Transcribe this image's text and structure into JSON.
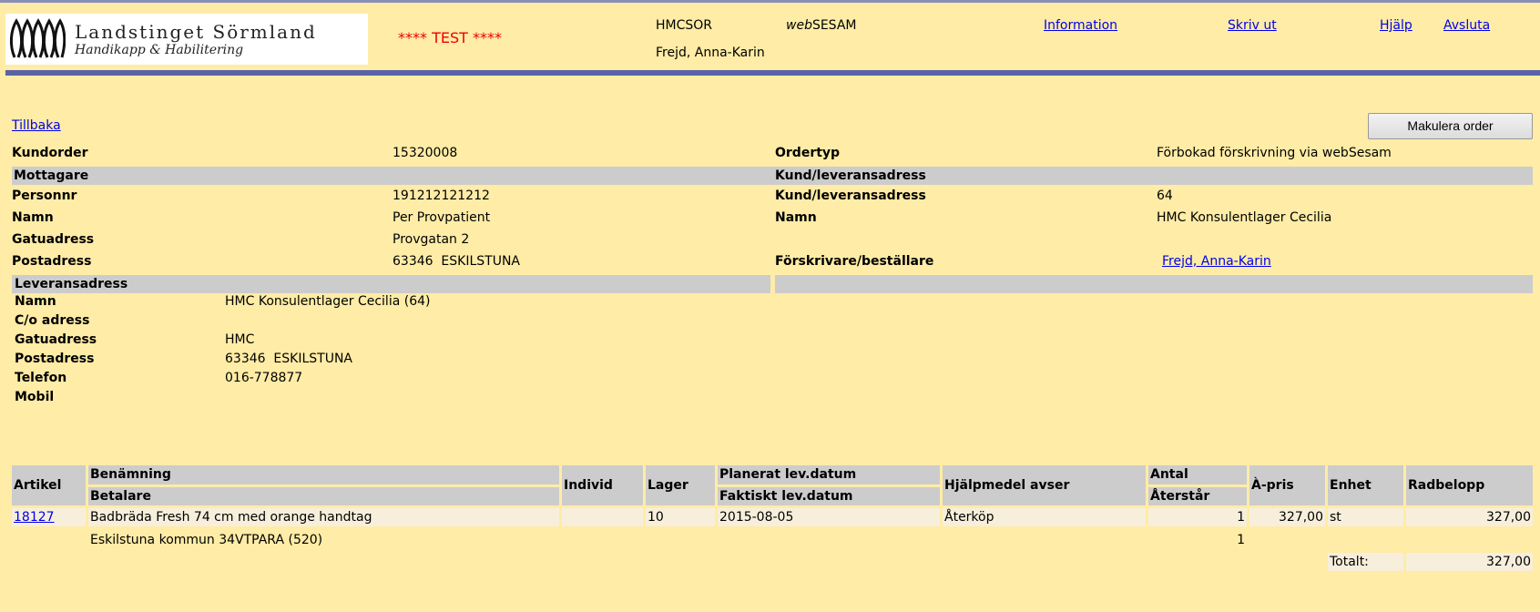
{
  "header": {
    "logo_line1": "Landstinget Sörmland",
    "logo_line2": "Handikapp & Habilitering",
    "test_label": "**** TEST ****",
    "system_code": "HMCSOR",
    "app_name_italic": "web",
    "app_name_rest": "SESAM",
    "user": "Frejd, Anna-Karin",
    "links": [
      "Information",
      "Skriv ut",
      "Hjälp",
      "Avsluta"
    ]
  },
  "nav": {
    "back": "Tillbaka",
    "cancel_order": "Makulera order"
  },
  "order": {
    "kundorder_label": "Kundorder",
    "kundorder": "15320008",
    "ordertyp_label": "Ordertyp",
    "ordertyp": "Förbokad förskrivning via webSesam",
    "mottagare_band": "Mottagare",
    "kund_band": "Kund/leveransadress",
    "personnr_label": "Personnr",
    "personnr": "191212121212",
    "kundlev_label": "Kund/leveransadress",
    "kundlev": "64",
    "namn_label": "Namn",
    "namn": "Per Provpatient",
    "namn2_label": "Namn",
    "namn2": "HMC Konsulentlager Cecilia",
    "gatuadress_label": "Gatuadress",
    "gatuadress": "Provgatan 2",
    "postadress_label": "Postadress",
    "postadress": "63346  ESKILSTUNA",
    "forskrivare_label": "Förskrivare/beställare",
    "forskrivare": "Frejd, Anna-Karin"
  },
  "delivery": {
    "band": "Leveransadress",
    "rows": [
      {
        "label": "Namn",
        "value": "HMC Konsulentlager Cecilia (64)"
      },
      {
        "label": "C/o adress",
        "value": ""
      },
      {
        "label": "Gatuadress",
        "value": "HMC"
      },
      {
        "label": "Postadress",
        "value": "63346  ESKILSTUNA"
      },
      {
        "label": "Telefon",
        "value": "016-778877"
      },
      {
        "label": "Mobil",
        "value": ""
      }
    ]
  },
  "table": {
    "headers": {
      "artikel": "Artikel",
      "benamning": "Benämning",
      "betalare": "Betalare",
      "individ": "Individ",
      "lager": "Lager",
      "planerat": "Planerat lev.datum",
      "faktiskt": "Faktiskt lev.datum",
      "avser": "Hjälpmedel avser",
      "antal": "Antal",
      "aterstar": "Återstår",
      "apris": "À-pris",
      "enhet": "Enhet",
      "radbelopp": "Radbelopp"
    },
    "row": {
      "artikel": "18127",
      "benamning": "Badbräda Fresh 74 cm med orange handtag",
      "individ": "",
      "lager": "10",
      "datum": "2015-08-05",
      "avser": "Återköp",
      "antal": "1",
      "apris": "327,00",
      "enhet": "st",
      "radbelopp": "327,00",
      "betalare": "Eskilstuna kommun 34VTPARA (520)",
      "aterstar": "1"
    },
    "total_label": "Totalt:",
    "total": "327,00"
  }
}
